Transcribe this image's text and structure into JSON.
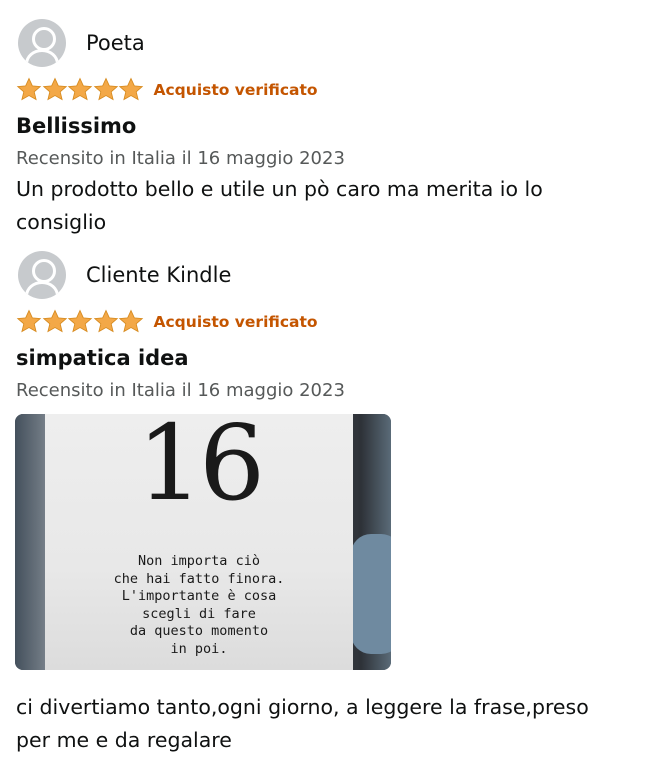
{
  "reviews": [
    {
      "username": "Poeta",
      "rating": 5,
      "verified_label": "Acquisto verificato",
      "title": "Bellissimo",
      "date": "Recensito in Italia il 16 maggio 2023",
      "body": "Un prodotto bello e utile un pò caro ma merita io lo consiglio"
    },
    {
      "username": "Cliente Kindle",
      "rating": 5,
      "verified_label": "Acquisto verificato",
      "title": "simpatica idea",
      "date": "Recensito in Italia il 16 maggio 2023",
      "image": {
        "number": "16",
        "quote_lines": [
          "Non importa ciò",
          "che hai fatto finora.",
          "L'importante è cosa",
          "scegli di fare",
          "da questo momento",
          "in poi."
        ]
      },
      "body": "ci divertiamo tanto,ogni giorno, a leggere la frase,preso per me e da regalare"
    }
  ],
  "colors": {
    "star": "#f3a847",
    "verified": "#c45500",
    "date": "#565959",
    "text": "#0f1111"
  }
}
